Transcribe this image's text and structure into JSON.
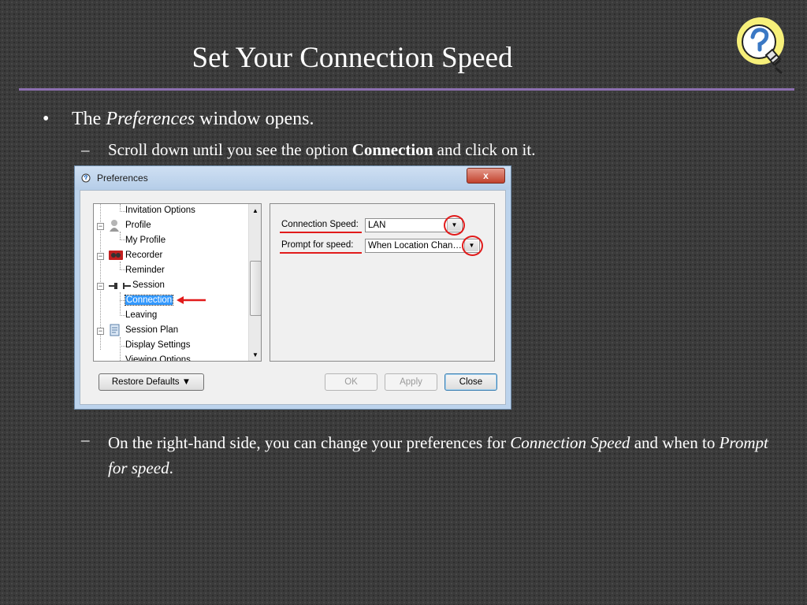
{
  "slide": {
    "title": "Set Your Connection Speed",
    "bullet_marker": "•",
    "bullet_text_pre": "The ",
    "bullet_text_italic": "Preferences",
    "bullet_text_post": " window opens.",
    "sub_marker": "–",
    "sub1_pre": "Scroll down until you see the option ",
    "sub1_bold": "Connection",
    "sub1_post": " and click on it.",
    "sub2_pre": "On the right-hand side, you can change your preferences for ",
    "sub2_italic1": "Connection Speed",
    "sub2_mid": " and when to ",
    "sub2_italic2": "Prompt for speed",
    "sub2_post": "."
  },
  "window": {
    "title": "Preferences",
    "close_label": "x",
    "tree": {
      "items": [
        {
          "label": "Invitation Options"
        },
        {
          "label": "Profile"
        },
        {
          "label": "My Profile"
        },
        {
          "label": "Recorder"
        },
        {
          "label": "Reminder"
        },
        {
          "label": "Session"
        },
        {
          "label": "Connection"
        },
        {
          "label": "Leaving"
        },
        {
          "label": "Session Plan"
        },
        {
          "label": "Display Settings"
        },
        {
          "label": "Viewing Options"
        }
      ],
      "selected": "Connection"
    },
    "settings": {
      "connection_speed_label": "Connection Speed:",
      "connection_speed_value": "LAN",
      "prompt_label": "Prompt for speed:",
      "prompt_value": "When Location Chan…"
    },
    "buttons": {
      "restore_defaults": "Restore Defaults",
      "ok": "OK",
      "apply": "Apply",
      "close": "Close"
    },
    "annotation_color": "#e11b1b"
  }
}
